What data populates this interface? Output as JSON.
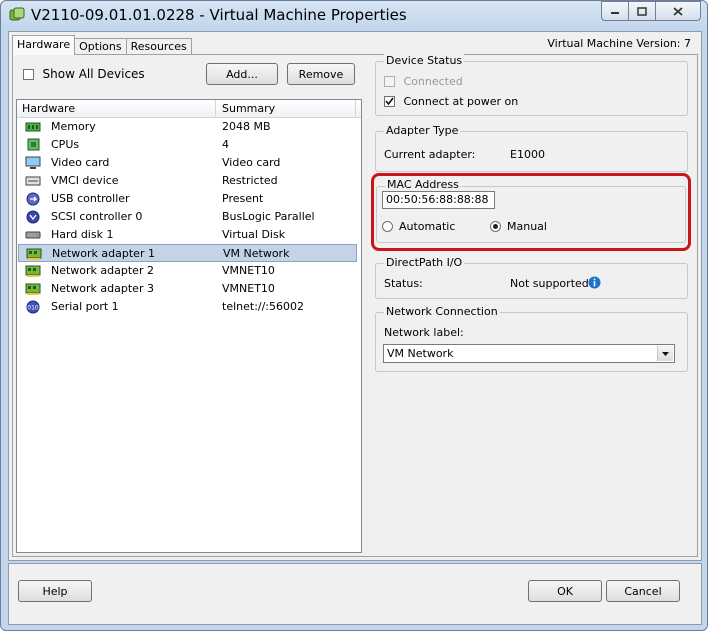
{
  "window": {
    "title": "V2110-09.01.01.0228 - Virtual Machine Properties",
    "vm_version": "Virtual Machine Version: 7"
  },
  "tabs": [
    {
      "label": "Hardware",
      "active": true
    },
    {
      "label": "Options",
      "active": false
    },
    {
      "label": "Resources",
      "active": false
    }
  ],
  "hardware": {
    "show_all_label": "Show All Devices",
    "show_all_checked": false,
    "add_label": "Add...",
    "remove_label": "Remove",
    "columns": [
      "Hardware",
      "Summary"
    ],
    "rows": [
      {
        "name": "Memory",
        "summary": "2048 MB",
        "icon": "memory-icon",
        "selected": false
      },
      {
        "name": "CPUs",
        "summary": "4",
        "icon": "cpu-icon",
        "selected": false
      },
      {
        "name": "Video card",
        "summary": "Video card",
        "icon": "video-card-icon",
        "selected": false
      },
      {
        "name": "VMCI device",
        "summary": "Restricted",
        "icon": "vmci-icon",
        "selected": false
      },
      {
        "name": "USB controller",
        "summary": "Present",
        "icon": "usb-icon",
        "selected": false
      },
      {
        "name": "SCSI controller 0",
        "summary": "BusLogic Parallel",
        "icon": "scsi-icon",
        "selected": false
      },
      {
        "name": "Hard disk 1",
        "summary": "Virtual Disk",
        "icon": "hard-disk-icon",
        "selected": false
      },
      {
        "name": "Network adapter 1",
        "summary": "VM Network",
        "icon": "network-adapter-icon",
        "selected": true
      },
      {
        "name": "Network adapter 2",
        "summary": "VMNET10",
        "icon": "network-adapter-icon",
        "selected": false
      },
      {
        "name": "Network adapter 3",
        "summary": "VMNET10",
        "icon": "network-adapter-icon",
        "selected": false
      },
      {
        "name": "Serial port 1",
        "summary": "telnet://:56002",
        "icon": "serial-port-icon",
        "selected": false
      }
    ]
  },
  "device_status": {
    "legend": "Device Status",
    "connected_label": "Connected",
    "connected_checked": false,
    "connected_disabled": true,
    "power_on_label": "Connect at power on",
    "power_on_checked": true
  },
  "adapter_type": {
    "legend": "Adapter Type",
    "current_label": "Current adapter:",
    "current_value": "E1000"
  },
  "mac_address": {
    "legend": "MAC Address",
    "value": "00:50:56:88:88:88",
    "automatic_label": "Automatic",
    "manual_label": "Manual",
    "selected": "Manual",
    "highlight_color": "#c8161b"
  },
  "directpath": {
    "legend": "DirectPath I/O",
    "status_label": "Status:",
    "status_value": "Not supported"
  },
  "network_connection": {
    "legend": "Network Connection",
    "label": "Network label:",
    "value": "VM Network"
  },
  "footer": {
    "help_label": "Help",
    "ok_label": "OK",
    "cancel_label": "Cancel"
  }
}
